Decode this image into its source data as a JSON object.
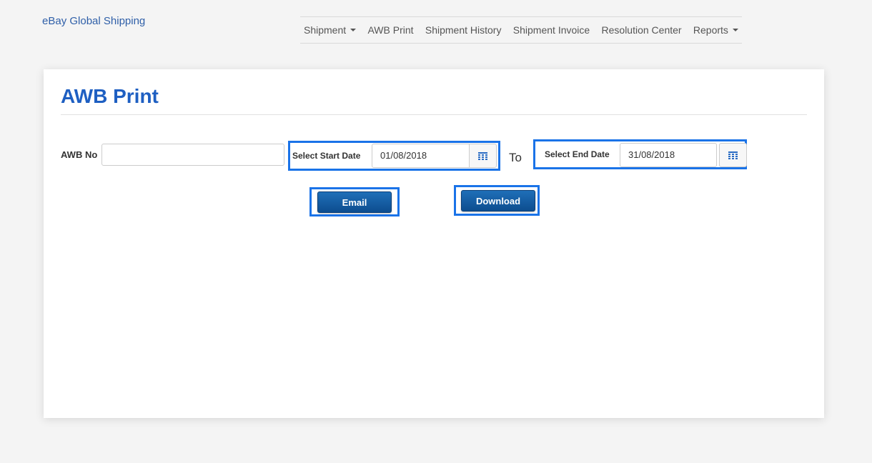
{
  "brand": "eBay Global Shipping",
  "nav": {
    "items": [
      {
        "label": "Shipment",
        "dropdown": true
      },
      {
        "label": "AWB Print",
        "dropdown": false
      },
      {
        "label": "Shipment History",
        "dropdown": false
      },
      {
        "label": "Shipment Invoice",
        "dropdown": false
      },
      {
        "label": "Resolution Center",
        "dropdown": false
      },
      {
        "label": "Reports",
        "dropdown": true
      }
    ]
  },
  "main": {
    "title": "AWB Print",
    "form": {
      "awb_label": "AWB No",
      "awb_value": "",
      "start_label": "Select Start Date",
      "start_value": "01/08/2018",
      "to_label": "To",
      "end_label": "Select End Date",
      "end_value": "31/08/2018",
      "calendar_icon": "calendar-icon"
    },
    "buttons": {
      "email": "Email",
      "download": "Download"
    }
  },
  "colors": {
    "brand_link": "#2f5fa8",
    "title": "#1e5fc2",
    "highlight_border": "#1a73e8",
    "button": "#1f6fb8"
  }
}
